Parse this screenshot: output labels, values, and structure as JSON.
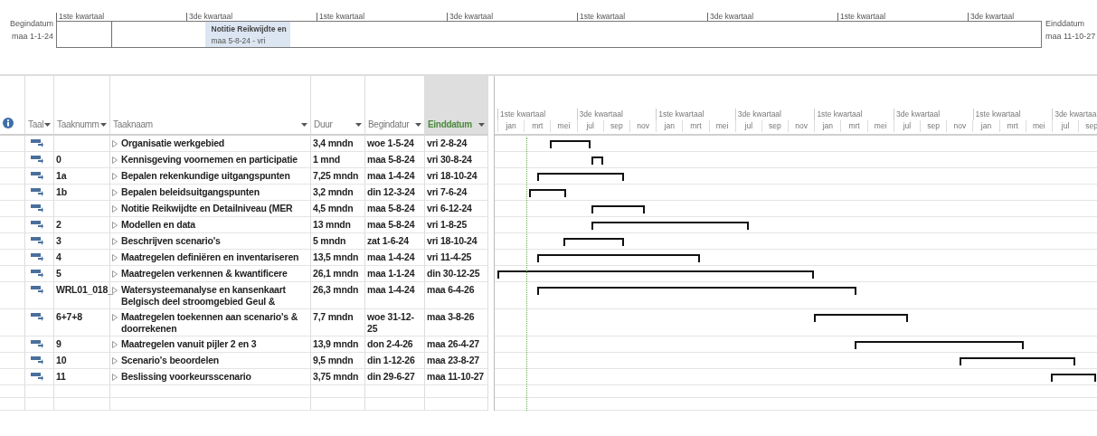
{
  "timeline": {
    "start_label": "Begindatum",
    "start_date": "maa 1-1-24",
    "end_label": "Einddatum",
    "end_date": "maa 11-10-27",
    "quarters": [
      "1ste kwartaal",
      "3de kwartaal",
      "1ste kwartaal",
      "3de kwartaal",
      "1ste kwartaal",
      "3de kwartaal",
      "1ste kwartaal",
      "3de kwartaal"
    ],
    "callout": {
      "title": "Notitie Reikwijdte en",
      "dates": "maa 5-8-24 - vri"
    }
  },
  "columns": [
    {
      "label": "Taal",
      "filter": true,
      "selected": false
    },
    {
      "label": "Taaknumm",
      "filter": true,
      "selected": false
    },
    {
      "label": "Taaknaam",
      "filter": true,
      "selected": false
    },
    {
      "label": "Duur",
      "filter": true,
      "selected": false
    },
    {
      "label": "Begindatur",
      "filter": true,
      "selected": false
    },
    {
      "label": "Einddatum",
      "filter": true,
      "selected": true
    }
  ],
  "gantt_scale": {
    "quarters": [
      "1ste kwartaal",
      "3de kwartaal",
      "1ste kwartaal",
      "3de kwartaal",
      "1ste kwartaal",
      "3de kwartaal",
      "1ste kwartaal",
      "3de kwartaal"
    ],
    "months": [
      "jan",
      "mrt",
      "mei",
      "jul",
      "sep",
      "nov",
      "jan",
      "mrt",
      "mei",
      "jul",
      "sep",
      "nov",
      "jan",
      "mrt",
      "mei",
      "jul",
      "sep",
      "nov",
      "jan",
      "mrt",
      "mei",
      "jul",
      "sep"
    ]
  },
  "tasks": [
    {
      "name": "Organisatie werkgebied",
      "duration": "3,4 mndn",
      "start": "woe 1-5-24",
      "end": "vri 2-8-24"
    },
    {
      "number": "0",
      "name": "Kennisgeving voornemen en participatie",
      "duration": "1 mnd",
      "start": "maa 5-8-24",
      "end": "vri 30-8-24"
    },
    {
      "number": "1a",
      "name": "Bepalen rekenkundige uitgangspunten",
      "duration": "7,25 mndn",
      "start": "maa 1-4-24",
      "end": "vri 18-10-24"
    },
    {
      "number": "1b",
      "name": "Bepalen beleidsuitgangspunten",
      "duration": "3,2 mndn",
      "start": "din 12-3-24",
      "end": "vri 7-6-24"
    },
    {
      "name": "Notitie Reikwijdte en Detailniveau (MER",
      "duration": "4,5 mndn",
      "start": "maa 5-8-24",
      "end": "vri 6-12-24"
    },
    {
      "number": "2",
      "name": "Modellen en data",
      "duration": "13 mndn",
      "start": "maa 5-8-24",
      "end": "vri 1-8-25"
    },
    {
      "number": "3",
      "name": "Beschrijven scenario's",
      "duration": "5 mndn",
      "start": "zat 1-6-24",
      "end": "vri 18-10-24"
    },
    {
      "number": "4",
      "name": "Maatregelen definiëren en inventariseren",
      "duration": "13,5 mndn",
      "start": "maa 1-4-24",
      "end": "vri 11-4-25"
    },
    {
      "number": "5",
      "name": "Maatregelen verkennen & kwantificere",
      "duration": "26,1 mndn",
      "start": "maa 1-1-24",
      "end": "din 30-12-25"
    },
    {
      "number": "WRL01_018_",
      "name": "Watersysteemanalyse en kansenkaart Belgisch deel stroomgebied Geul &",
      "duration": "26,3 mndn",
      "start": "maa 1-4-24",
      "end": "maa 6-4-26"
    },
    {
      "number": "6+7+8",
      "name": "Maatregelen toekennen aan scenario's & doorrekenen",
      "duration": "7,7 mndn",
      "start": "woe 31-12-25",
      "end": "maa 3-8-26"
    },
    {
      "number": "9",
      "name": "Maatregelen vanuit pijler 2 en 3",
      "duration": "13,9 mndn",
      "start": "don 2-4-26",
      "end": "maa 26-4-27"
    },
    {
      "number": "10",
      "name": "Scenario's beoordelen",
      "duration": "9,5 mndn",
      "start": "din 1-12-26",
      "end": "maa 23-8-27"
    },
    {
      "number": "11",
      "name": "Beslissing voorkeursscenario",
      "duration": "3,75 mndn",
      "start": "din 29-6-27",
      "end": "maa 11-10-27"
    }
  ]
}
